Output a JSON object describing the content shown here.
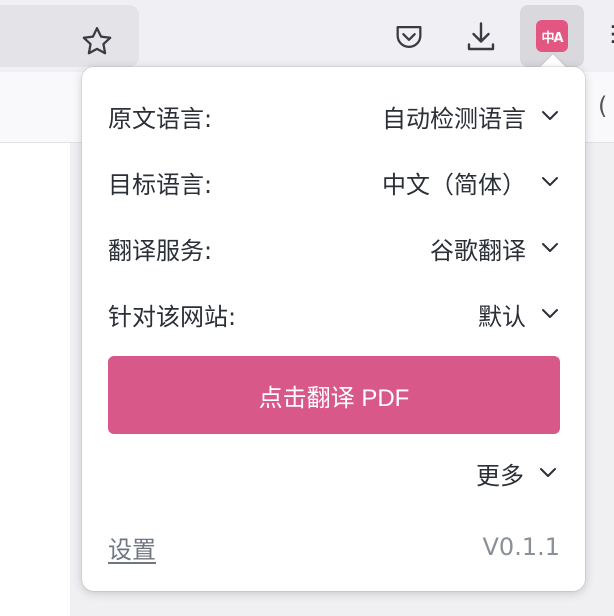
{
  "toolbar": {
    "icons": [
      "star-icon",
      "pocket-icon",
      "download-icon"
    ],
    "extension_icon_label": "中A",
    "accent": "#e35681"
  },
  "popup": {
    "rows": [
      {
        "label": "原文语言:",
        "value": "自动检测语言"
      },
      {
        "label": "目标语言:",
        "value": "中文（简体）"
      },
      {
        "label": "翻译服务:",
        "value": "谷歌翻译"
      },
      {
        "label": "针对该网站:",
        "value": "默认"
      }
    ],
    "translate_pdf_button": "点击翻译 PDF",
    "more_label": "更多",
    "settings_link": "设置",
    "version": "V0.1.1",
    "button_color": "#d9588a"
  }
}
